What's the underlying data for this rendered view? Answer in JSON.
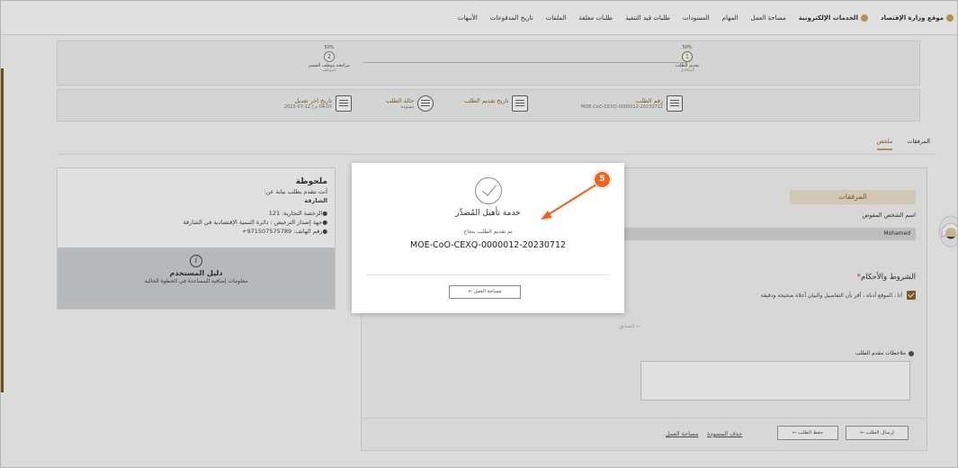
{
  "nav": {
    "items": [
      {
        "label": "موقع وزارة الإقتصاد",
        "icon": "globe-icon"
      },
      {
        "label": "الخدمات الإلكترونية",
        "icon": "services-icon"
      },
      {
        "label": "مساحة العمل"
      },
      {
        "label": "المهام"
      },
      {
        "label": "المسودات"
      },
      {
        "label": "طلبات قيد التنفيذ"
      },
      {
        "label": "طلبات مغلقة"
      },
      {
        "label": "الملفات"
      },
      {
        "label": "تاريخ المدفوعات"
      },
      {
        "label": "الأنبهات"
      }
    ]
  },
  "steps": [
    {
      "pct": "50%",
      "num": "1",
      "label": "تقديم الطلب",
      "sub": "المتعامل"
    },
    {
      "pct": "50%",
      "num": "2",
      "label": "مراجعة موظف القسم",
      "sub": "الموظف"
    }
  ],
  "info": {
    "request_no_label": "رقم الطلب",
    "request_no": "MOE-CoO-CEXQ-0000012-20230712",
    "submit_date_label": "تاريخ تقديم الطلب",
    "submit_date": "-",
    "status_label": "حالة الطلب",
    "status": "مسودة",
    "last_mod_label": "تاريخ اخر تعديل",
    "last_mod": "04:07 م | 12-07-2023"
  },
  "tabs": [
    "المرفقات",
    "ملخص"
  ],
  "note": {
    "title": "ملحوظة",
    "line1": "أنت تتقدم بطلب نيابة عن:",
    "entity": "الشارقة",
    "license": "●الرخصة التجارية: 121",
    "authority": "●جهة إصدار الترخيص : دائرة التنمية الإقتصادية في الشارقة",
    "phone": "●رقم الهاتف: 971507575789+"
  },
  "guide": {
    "title": "دليل المستخدم",
    "sub": "معلومات إضافية للمساعدة في الخطوة الحالية"
  },
  "form": {
    "attachments_header": "المرفقات",
    "delegate_label": "اسم الشخص المفوض",
    "delegate_value": "Mohamed",
    "terms_title": "الشروط والأحكام",
    "terms_required": "*",
    "terms_text": "أنا ، الموقع أدناه ، أقر بأن التفاصيل والبيان أعلاه صحيحة ودقيقة",
    "prev_label": "السابق",
    "notes_label": "ملاحظات مقدم الطلب",
    "submit_label": "إرسال الطلب",
    "save_label": "حفظ الطلب",
    "delete_draft_label": "حذف المسودة",
    "workspace_link": "مساحة العمل"
  },
  "modal": {
    "title": "خدمة تأهيل المُصدِّر",
    "sub": "تم تقديم الطلب بنجاح",
    "ref": "MOE-CoO-CEXQ-0000012-20230712",
    "button": "مساحة العمل"
  },
  "annotation": {
    "badge": "5",
    "color": "#f0631f"
  },
  "colors": {
    "accent": "#8b6a2a",
    "accent_light": "#ede4cf",
    "annotation": "#f0631f"
  }
}
